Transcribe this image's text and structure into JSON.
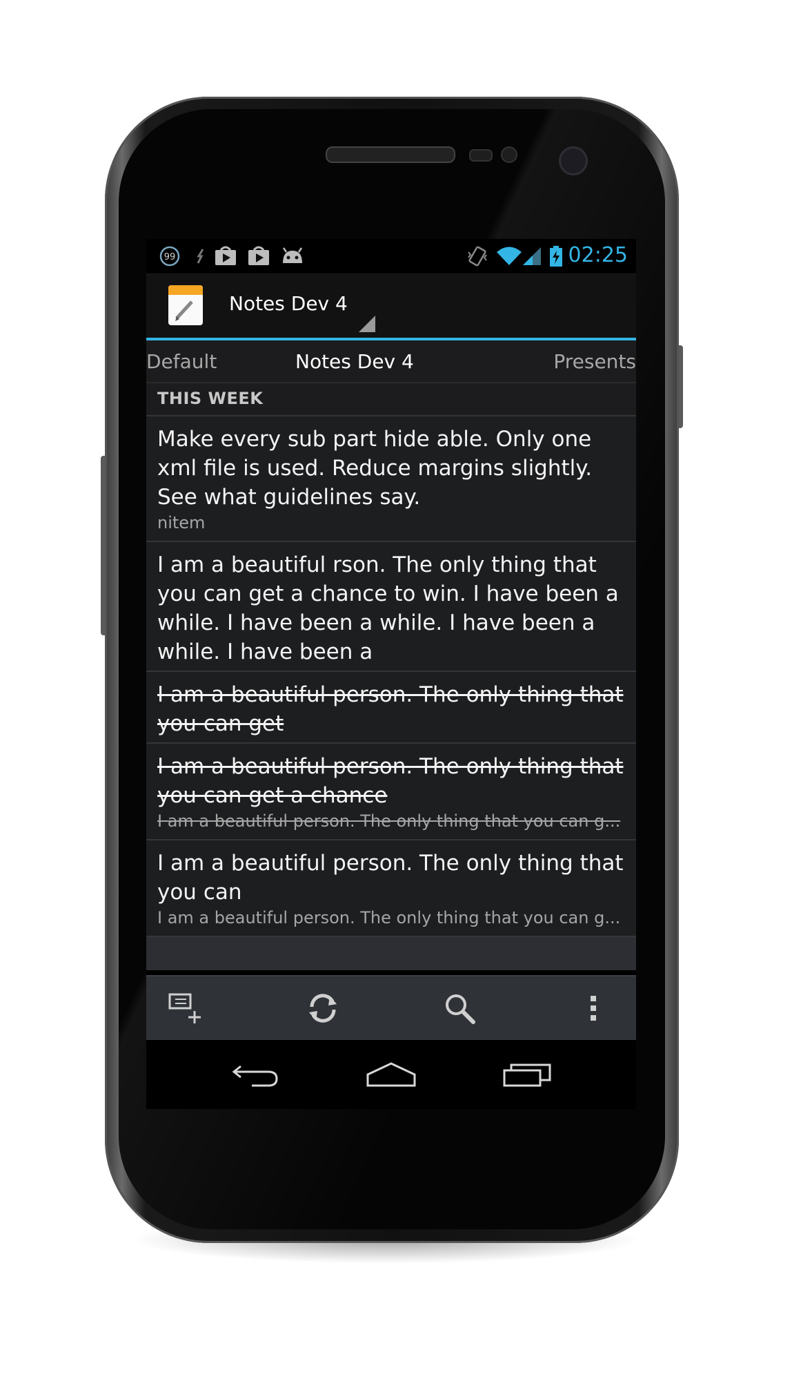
{
  "status_bar": {
    "notification_badge": "99",
    "time": "02:25",
    "icons": [
      "notification-count-icon",
      "usb-icon",
      "play-store-icon",
      "play-store-icon",
      "android-icon",
      "vibrate-icon",
      "wifi-icon",
      "signal-icon",
      "battery-charging-icon"
    ]
  },
  "action_bar": {
    "title": "Notes Dev 4",
    "icon": "notes-app-icon"
  },
  "tabs": [
    {
      "label": "Default"
    },
    {
      "label": "Notes Dev 4"
    },
    {
      "label": "Presents"
    }
  ],
  "section": {
    "header": "THIS WEEK"
  },
  "notes": [
    {
      "title": "Make every sub part hide able. Only one xml file is used. Reduce margins slightly. See what guidelines say.",
      "subtitle": "nitem",
      "completed": false
    },
    {
      "title": "I am a beautiful rson. The only thing that you can get a chance to win. I have been a while. I have been a while. I have been a while. I have been a",
      "subtitle": "",
      "completed": false
    },
    {
      "title": "I am a beautiful person. The only thing that you can get ",
      "subtitle": "",
      "completed": true
    },
    {
      "title": "I am a beautiful person. The only thing that you can get a chance",
      "subtitle": "I am a beautiful person. The only thing that you can g...",
      "completed": true
    },
    {
      "title": "I am a beautiful person. The only thing that you can",
      "subtitle": "I am a beautiful person. The only thing that you can g...",
      "completed": false
    }
  ],
  "bottom_bar": {
    "buttons": [
      "new-note-icon",
      "sync-icon",
      "search-icon",
      "overflow-menu-icon"
    ]
  },
  "nav_bar": {
    "buttons": [
      "back-icon",
      "home-icon",
      "recent-apps-icon"
    ]
  },
  "colors": {
    "accent": "#33b5e5",
    "background": "#1d1e20"
  }
}
